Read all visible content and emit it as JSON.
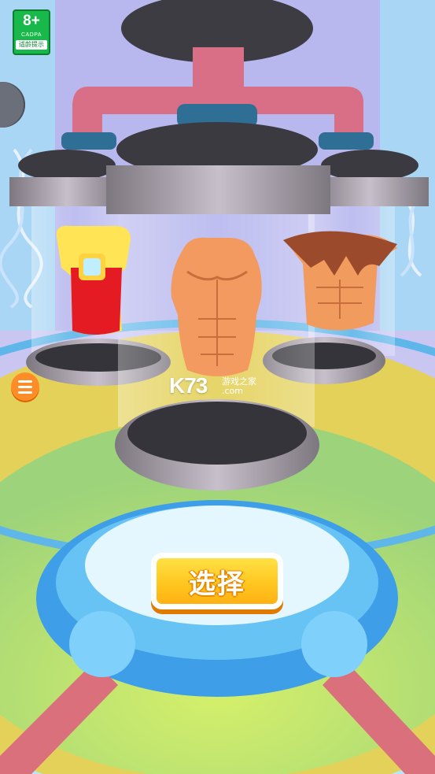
{
  "age_rating": {
    "rating": "8+",
    "org": "CADPA",
    "tip": "适龄提示"
  },
  "select_button": {
    "label": "选择"
  },
  "watermark": {
    "logo": "K73",
    "site_name": "游戏之家",
    "domain": ".com"
  },
  "icons": {
    "menu": "list-icon",
    "side": "chest-icon"
  },
  "options": [
    "golden-armor-torso",
    "muscle-torso",
    "werewolf-torso"
  ],
  "colors": {
    "button": "#ffc61f",
    "menu": "#ff8d27",
    "badge": "#18b84a"
  }
}
